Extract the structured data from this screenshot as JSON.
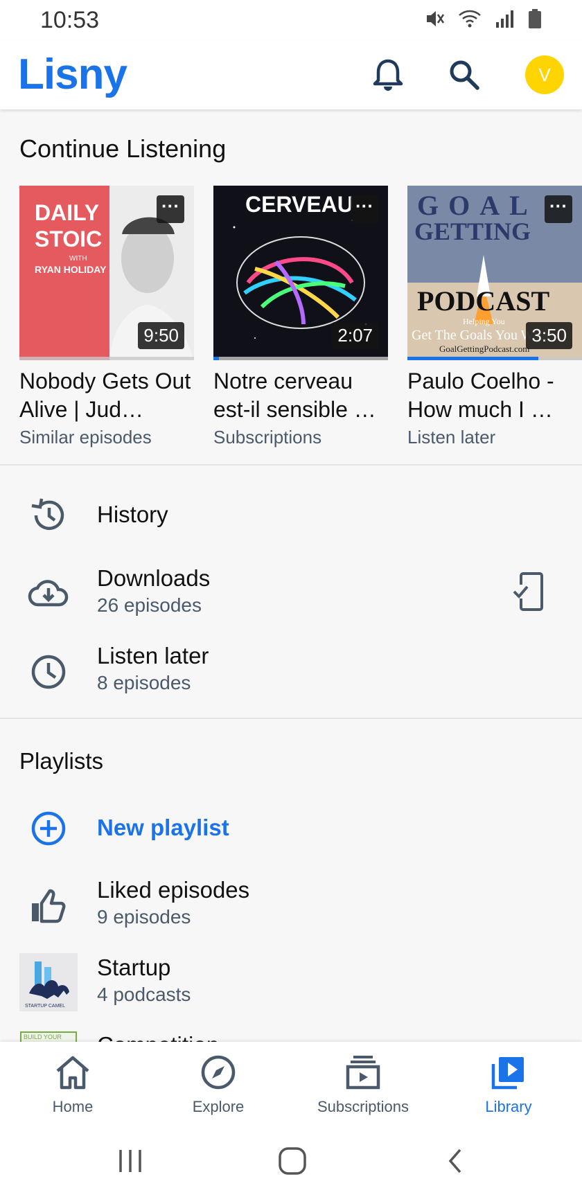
{
  "status_bar": {
    "time": "10:53"
  },
  "header": {
    "logo": "Lisny",
    "avatar_letter": "V"
  },
  "continue_listening": {
    "title": "Continue Listening",
    "cards": [
      {
        "title": "Nobody Gets Out Alive | Jud…",
        "source": "Similar episodes",
        "duration": "9:50",
        "progress": 0,
        "art_text": [
          "DAILY",
          "STOIC",
          "WITH",
          "RYAN HOLIDAY"
        ]
      },
      {
        "title": "Notre cerveau est-il sensible …",
        "source": "Subscriptions",
        "duration": "2:07",
        "progress": 0.03,
        "art_text": [
          "CERVEAU"
        ]
      },
      {
        "title": "Paulo Coelho - How much I …",
        "source": "Listen later",
        "duration": "3:50",
        "progress": 0.75,
        "art_text": [
          "GOAL",
          "GETTING",
          "PODCAST",
          "Helping You",
          "Get The Goals You Want",
          "GoalGettingPodcast.com"
        ]
      }
    ]
  },
  "library": {
    "history": {
      "label": "History"
    },
    "downloads": {
      "label": "Downloads",
      "count": "26 episodes"
    },
    "listen_later": {
      "label": "Listen later",
      "count": "8 episodes"
    }
  },
  "playlists": {
    "title": "Playlists",
    "new_playlist": "New playlist",
    "items": [
      {
        "label": "Liked episodes",
        "count": "9 episodes"
      },
      {
        "label": "Startup",
        "count": "4 podcasts",
        "art_text": "STARTUP CAMEL"
      },
      {
        "label": "Competition",
        "art_text": "BUILD YOUR"
      }
    ]
  },
  "bottom_nav": {
    "items": [
      {
        "label": "Home",
        "icon": "home-icon"
      },
      {
        "label": "Explore",
        "icon": "compass-icon"
      },
      {
        "label": "Subscriptions",
        "icon": "subscriptions-icon"
      },
      {
        "label": "Library",
        "icon": "library-icon",
        "active": true
      }
    ]
  },
  "colors": {
    "accent": "#1a73e8",
    "avatar": "#ffd400",
    "secondary_text": "#4a5a6a"
  }
}
